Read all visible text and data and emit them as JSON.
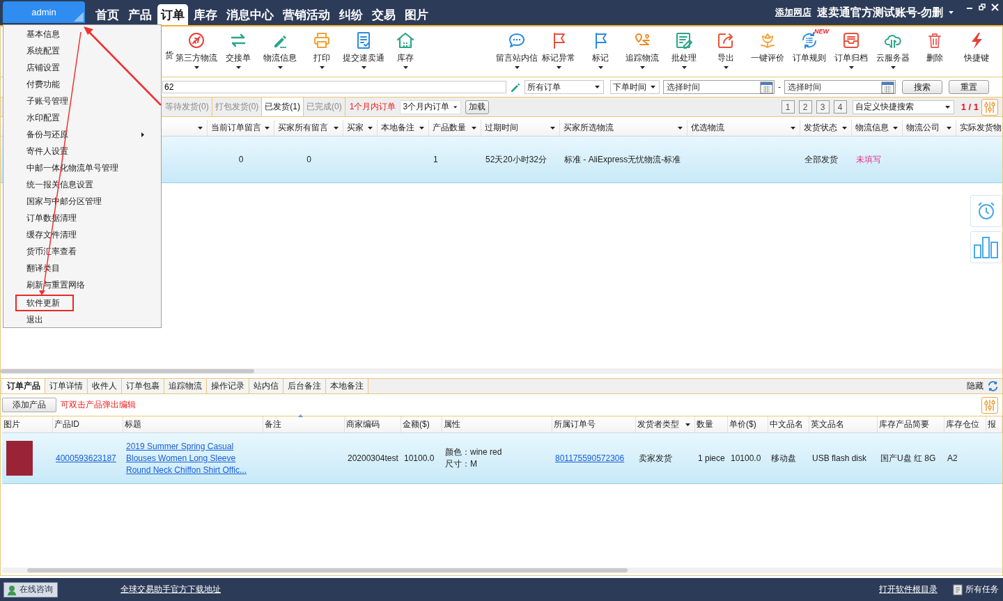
{
  "top_bar": {
    "account_button": "admin",
    "nav": [
      {
        "label": "首页",
        "selected": false
      },
      {
        "label": "产品",
        "selected": false
      },
      {
        "label": "订单",
        "selected": true
      },
      {
        "label": "库存",
        "selected": false
      },
      {
        "label": "消息中心",
        "selected": false
      },
      {
        "label": "营销活动",
        "selected": false
      },
      {
        "label": "纠纷",
        "selected": false
      },
      {
        "label": "交易",
        "selected": false
      },
      {
        "label": "图片",
        "selected": false
      }
    ],
    "add_store_link": "添加网店",
    "account_name": "速卖通官方测试账号-勿删"
  },
  "account_menu": [
    {
      "label": "基本信息",
      "submenu": false,
      "boxed": false
    },
    {
      "label": "系统配置",
      "submenu": false,
      "boxed": false
    },
    {
      "label": "店铺设置",
      "submenu": false,
      "boxed": false
    },
    {
      "label": "付费功能",
      "submenu": false,
      "boxed": false
    },
    {
      "label": "子账号管理",
      "submenu": false,
      "boxed": false
    },
    {
      "label": "水印配置",
      "submenu": false,
      "boxed": false
    },
    {
      "label": "备份与还原",
      "submenu": true,
      "boxed": false
    },
    {
      "label": "寄件人设置",
      "submenu": false,
      "boxed": false
    },
    {
      "label": "中邮一体化物流单号管理",
      "submenu": false,
      "boxed": false
    },
    {
      "label": "统一报关信息设置",
      "submenu": false,
      "boxed": false
    },
    {
      "label": "国家与中邮分区管理",
      "submenu": false,
      "boxed": false
    },
    {
      "label": "订单数据清理",
      "submenu": false,
      "boxed": false
    },
    {
      "label": "缓存文件清理",
      "submenu": false,
      "boxed": false
    },
    {
      "label": "货币汇率查看",
      "submenu": false,
      "boxed": false
    },
    {
      "label": "翻译类目",
      "submenu": false,
      "boxed": false
    },
    {
      "label": "刷新与重置网络",
      "submenu": false,
      "boxed": false
    },
    {
      "label": "软件更新",
      "submenu": false,
      "boxed": true
    },
    {
      "label": "退出",
      "submenu": false,
      "boxed": false
    }
  ],
  "toolbar": {
    "left": [
      {
        "label": "货",
        "has_menu": false
      },
      {
        "label": "第三方物流",
        "has_menu": true
      },
      {
        "label": "交接单",
        "has_menu": true
      },
      {
        "label": "物流信息",
        "has_menu": true
      },
      {
        "label": "打印",
        "has_menu": true
      },
      {
        "label": "提交速卖通",
        "has_menu": true
      },
      {
        "label": "库存",
        "has_menu": true
      }
    ],
    "right": [
      {
        "label": "留言站内信",
        "has_menu": true
      },
      {
        "label": "标记异常",
        "has_menu": true
      },
      {
        "label": "标记",
        "has_menu": true
      },
      {
        "label": "追踪物流",
        "has_menu": true
      },
      {
        "label": "批处理",
        "has_menu": true
      },
      {
        "label": "导出",
        "has_menu": true
      },
      {
        "label": "一键评价",
        "has_menu": false
      },
      {
        "label": "订单规则",
        "has_menu": false,
        "badge": "NEW"
      },
      {
        "label": "订单归档",
        "has_menu": true
      },
      {
        "label": "云服务器",
        "has_menu": true
      },
      {
        "label": "删除",
        "has_menu": false
      },
      {
        "label": "快捷键",
        "has_menu": false
      }
    ]
  },
  "filters": {
    "search": "62",
    "order_type": "所有订单",
    "time_type": "下单时间",
    "date_from_placeholder": "选择时间",
    "separator": "-",
    "date_to_placeholder": "选择时间",
    "buttons": [
      "搜索",
      "重置"
    ]
  },
  "status_tabs": [
    {
      "label": "等待发货(0)",
      "selected": false
    },
    {
      "label": "打包发货(0)",
      "selected": false
    },
    {
      "label": "已发货(1)",
      "selected": true
    },
    {
      "label": "已完成(0)",
      "selected": false
    }
  ],
  "period_link": "1个月内订单",
  "period_select": "3个月内订单",
  "load_button": "加载",
  "pages": [
    "1",
    "2",
    "3",
    "4"
  ],
  "quick_search": "自定义快捷搜索",
  "page_indicator": "1 / 1",
  "orders": {
    "columns": [
      {
        "filter": true
      },
      {
        "label": "当前订单留言",
        "filter": true
      },
      {
        "label": "买家所有留言",
        "filter": true
      },
      {
        "label": "买家",
        "filter": true
      },
      {
        "label": "本地备注",
        "filter": true
      },
      {
        "label": "产品数量",
        "filter": true
      },
      {
        "label": "过期时间",
        "filter": true
      },
      {
        "label": "买家所选物流",
        "filter": true
      },
      {
        "label": "优选物流",
        "filter": true
      },
      {
        "label": "发货状态",
        "filter": true
      },
      {
        "label": "物流信息",
        "filter": true
      },
      {
        "label": "物流公司",
        "filter": true
      },
      {
        "label": "实际发货物",
        "filter": false
      }
    ],
    "rows": [
      {
        "selected": true,
        "cells": [
          null,
          {
            "text": "0"
          },
          {
            "text": "0"
          },
          null,
          null,
          {
            "text": "1"
          },
          {
            "text": "52天20小时32分"
          },
          {
            "text": "标准 - AliExpress无忧物流-标准"
          },
          null,
          {
            "text": "全部发货"
          },
          {
            "text": "未填写",
            "kind": "alert"
          },
          null,
          null
        ]
      }
    ]
  },
  "detail_tabs": [
    {
      "label": "订单产品",
      "selected": true
    },
    {
      "label": "订单详情",
      "selected": false
    },
    {
      "label": "收件人",
      "selected": false
    },
    {
      "label": "订单包裹",
      "selected": false
    },
    {
      "label": "追踪物流",
      "selected": false
    },
    {
      "label": "操作记录",
      "selected": false
    },
    {
      "label": "站内信",
      "selected": false
    },
    {
      "label": "后台备注",
      "selected": false
    },
    {
      "label": "本地备注",
      "selected": false
    }
  ],
  "hide_link": "隐藏",
  "add_product_button": "添加产品",
  "edit_hint": "可双击产品弹出编辑",
  "products": {
    "columns": [
      {
        "label": "图片",
        "filter": false,
        "sorted": false
      },
      {
        "label": "产品ID",
        "filter": false,
        "sorted": false
      },
      {
        "label": "标题",
        "filter": false,
        "sorted": false
      },
      {
        "label": "备注",
        "filter": false,
        "sorted": true
      },
      {
        "label": "商家编码",
        "filter": false,
        "sorted": false
      },
      {
        "label": "金额($)",
        "filter": false,
        "sorted": false
      },
      {
        "label": "属性",
        "filter": false,
        "sorted": false
      },
      {
        "label": "所属订单号",
        "filter": false,
        "sorted": false
      },
      {
        "label": "发货者类型",
        "filter": true,
        "sorted": false
      },
      {
        "label": "数量",
        "filter": false,
        "sorted": false
      },
      {
        "label": "单价($)",
        "filter": false,
        "sorted": false
      },
      {
        "label": "中文品名",
        "filter": false,
        "sorted": false
      },
      {
        "label": "英文品名",
        "filter": false,
        "sorted": false
      },
      {
        "label": "库存产品简要",
        "filter": false,
        "sorted": false
      },
      {
        "label": "库存仓位",
        "filter": false,
        "sorted": false
      },
      {
        "label": "报",
        "filter": false,
        "sorted": false
      }
    ],
    "rows": [
      {
        "selected": true,
        "cells": [
          {
            "kind": "photo"
          },
          {
            "kind": "link",
            "text": "4000593623187"
          },
          {
            "kind": "link",
            "text": "2019 Summer Spring Casual Blouses Women Long Sleeve Round Neck Chiffon Shirt Offic..."
          },
          null,
          {
            "kind": "text",
            "text": "20200304test"
          },
          {
            "kind": "text",
            "text": "10100.0"
          },
          {
            "kind": "lines",
            "lines": [
              "颜色：wine red",
              "尺寸：M"
            ]
          },
          {
            "kind": "link",
            "text": "801175590572306"
          },
          {
            "kind": "text",
            "text": "卖家发货"
          },
          {
            "kind": "text",
            "text": "1 piece"
          },
          {
            "kind": "text",
            "text": "10100.0"
          },
          {
            "kind": "text",
            "text": "移动盘"
          },
          {
            "kind": "text",
            "text": "USB flash disk"
          },
          {
            "kind": "text",
            "text": "国产U盘 红 8G"
          },
          {
            "kind": "text",
            "text": "A2"
          },
          null
        ]
      }
    ]
  },
  "status_bar": {
    "consult_button": "在线咨询",
    "download_link": "全球交易助手官方下载地址",
    "open_dir_link": "打开软件根目录",
    "tasks_button": "所有任务"
  }
}
